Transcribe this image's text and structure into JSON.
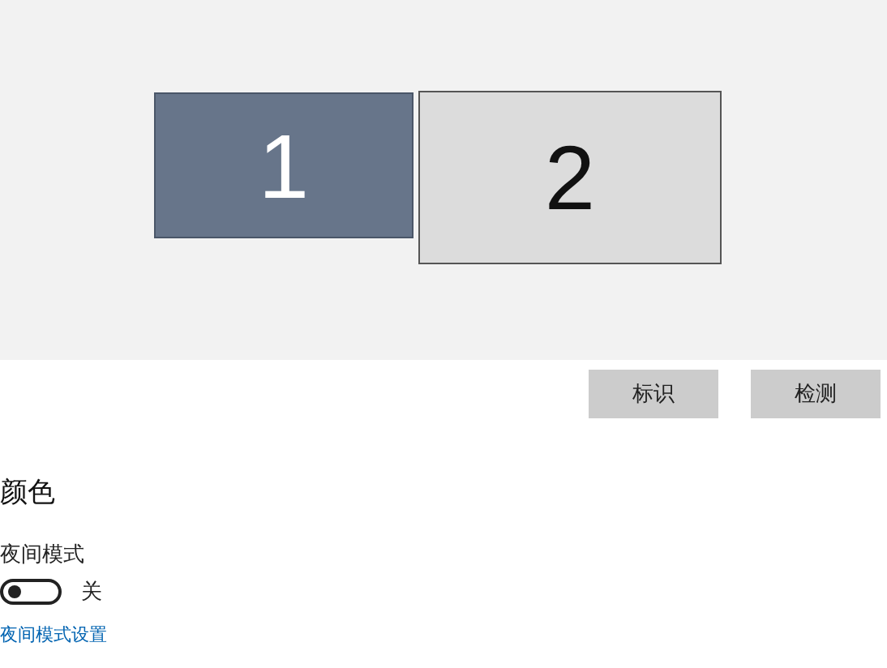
{
  "displays": [
    {
      "label": "1",
      "selected": true
    },
    {
      "label": "2",
      "selected": false
    }
  ],
  "buttons": [
    "标识",
    "检测"
  ],
  "section_title": "颜色",
  "night_light": {
    "label": "夜间模式",
    "on": false,
    "state_text": "关"
  },
  "link": "夜间模式设置"
}
